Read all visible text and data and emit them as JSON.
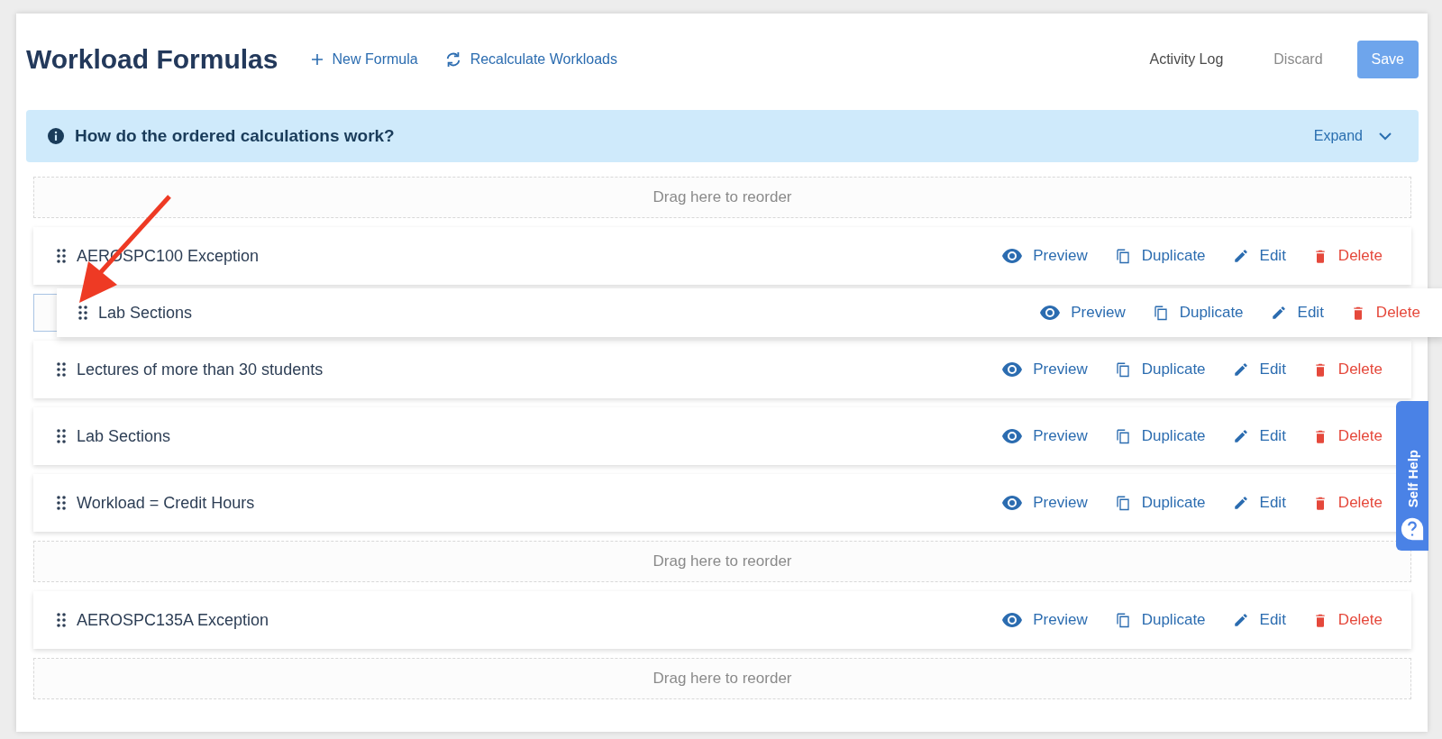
{
  "header": {
    "title": "Workload Formulas",
    "links": [
      {
        "kind": "add",
        "label": "New Formula"
      },
      {
        "kind": "refresh",
        "label": "Recalculate Workloads"
      }
    ],
    "buttons": [
      {
        "kind": "plain",
        "label": "Activity Log"
      },
      {
        "kind": "muted",
        "label": "Discard"
      },
      {
        "kind": "primary",
        "label": "Save"
      }
    ]
  },
  "banner": {
    "text": "How do the ordered calculations work?",
    "toggle": "Expand",
    "expanded": false
  },
  "items": [
    {
      "kind": "dropzone",
      "text": "Drag here to reorder",
      "active": false
    },
    {
      "kind": "formula",
      "name": "AEROSPC100 Exception",
      "actions": [
        {
          "kind": "preview",
          "label": "Preview"
        },
        {
          "kind": "duplicate",
          "label": "Duplicate"
        },
        {
          "kind": "edit",
          "label": "Edit"
        },
        {
          "kind": "delete",
          "label": "Delete"
        }
      ]
    },
    {
      "kind": "dropzone",
      "active": true,
      "dragged": {
        "name": "Lab Sections",
        "actions": [
          {
            "kind": "preview",
            "label": "Preview"
          },
          {
            "kind": "duplicate",
            "label": "Duplicate"
          },
          {
            "kind": "edit",
            "label": "Edit"
          },
          {
            "kind": "delete",
            "label": "Delete"
          }
        ]
      }
    },
    {
      "kind": "formula",
      "name": "Lectures of more than 30 students",
      "actions": [
        {
          "kind": "preview",
          "label": "Preview"
        },
        {
          "kind": "duplicate",
          "label": "Duplicate"
        },
        {
          "kind": "edit",
          "label": "Edit"
        },
        {
          "kind": "delete",
          "label": "Delete"
        }
      ]
    },
    {
      "kind": "formula",
      "name": "Lab Sections",
      "actions": [
        {
          "kind": "preview",
          "label": "Preview"
        },
        {
          "kind": "duplicate",
          "label": "Duplicate"
        },
        {
          "kind": "edit",
          "label": "Edit"
        },
        {
          "kind": "delete",
          "label": "Delete"
        }
      ]
    },
    {
      "kind": "formula",
      "name": "Workload = Credit Hours",
      "actions": [
        {
          "kind": "preview",
          "label": "Preview"
        },
        {
          "kind": "duplicate",
          "label": "Duplicate"
        },
        {
          "kind": "edit",
          "label": "Edit"
        },
        {
          "kind": "delete",
          "label": "Delete"
        }
      ]
    },
    {
      "kind": "dropzone",
      "text": "Drag here to reorder",
      "active": false
    },
    {
      "kind": "formula",
      "name": "AEROSPC135A Exception",
      "actions": [
        {
          "kind": "preview",
          "label": "Preview"
        },
        {
          "kind": "duplicate",
          "label": "Duplicate"
        },
        {
          "kind": "edit",
          "label": "Edit"
        },
        {
          "kind": "delete",
          "label": "Delete"
        }
      ]
    },
    {
      "kind": "dropzone",
      "text": "Drag here to reorder",
      "active": false
    }
  ],
  "help_tab": {
    "label": "Self Help"
  }
}
